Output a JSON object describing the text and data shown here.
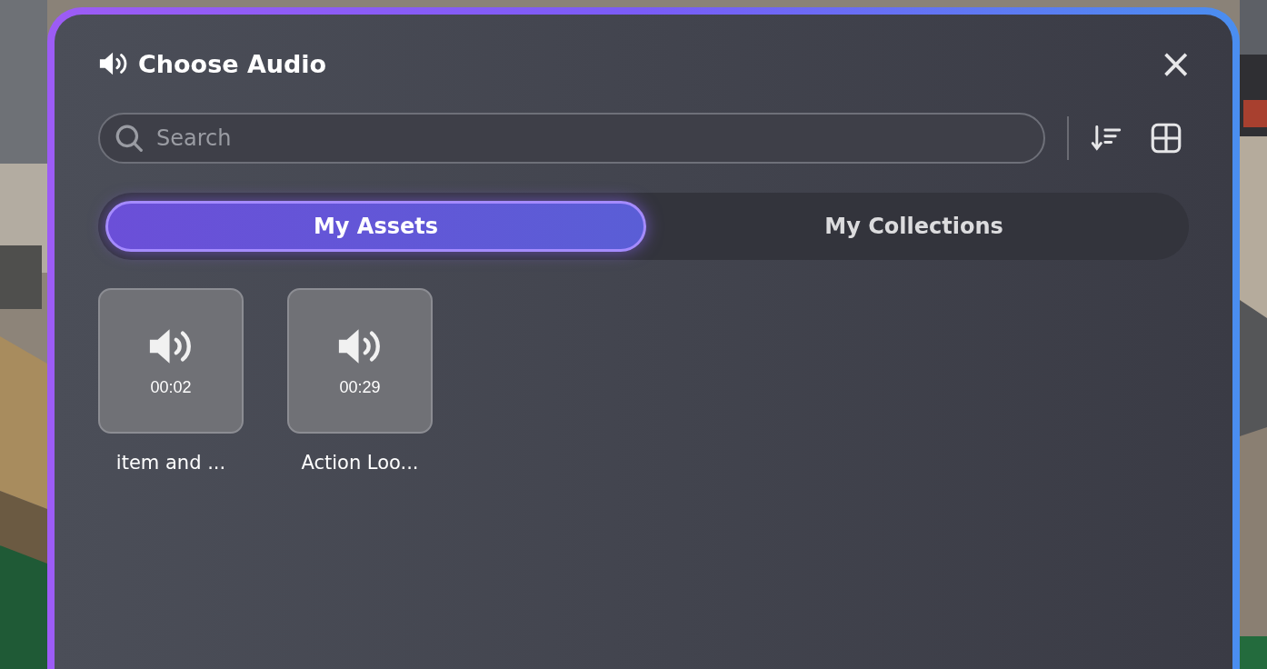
{
  "dialog": {
    "title": "Choose Audio",
    "close": "×"
  },
  "search": {
    "placeholder": "Search"
  },
  "tabs": [
    {
      "label": "My Assets",
      "selected": true
    },
    {
      "label": "My Collections",
      "selected": false
    }
  ],
  "assets": [
    {
      "duration": "00:02",
      "name": "item and ..."
    },
    {
      "duration": "00:29",
      "name": "Action Loo..."
    }
  ]
}
